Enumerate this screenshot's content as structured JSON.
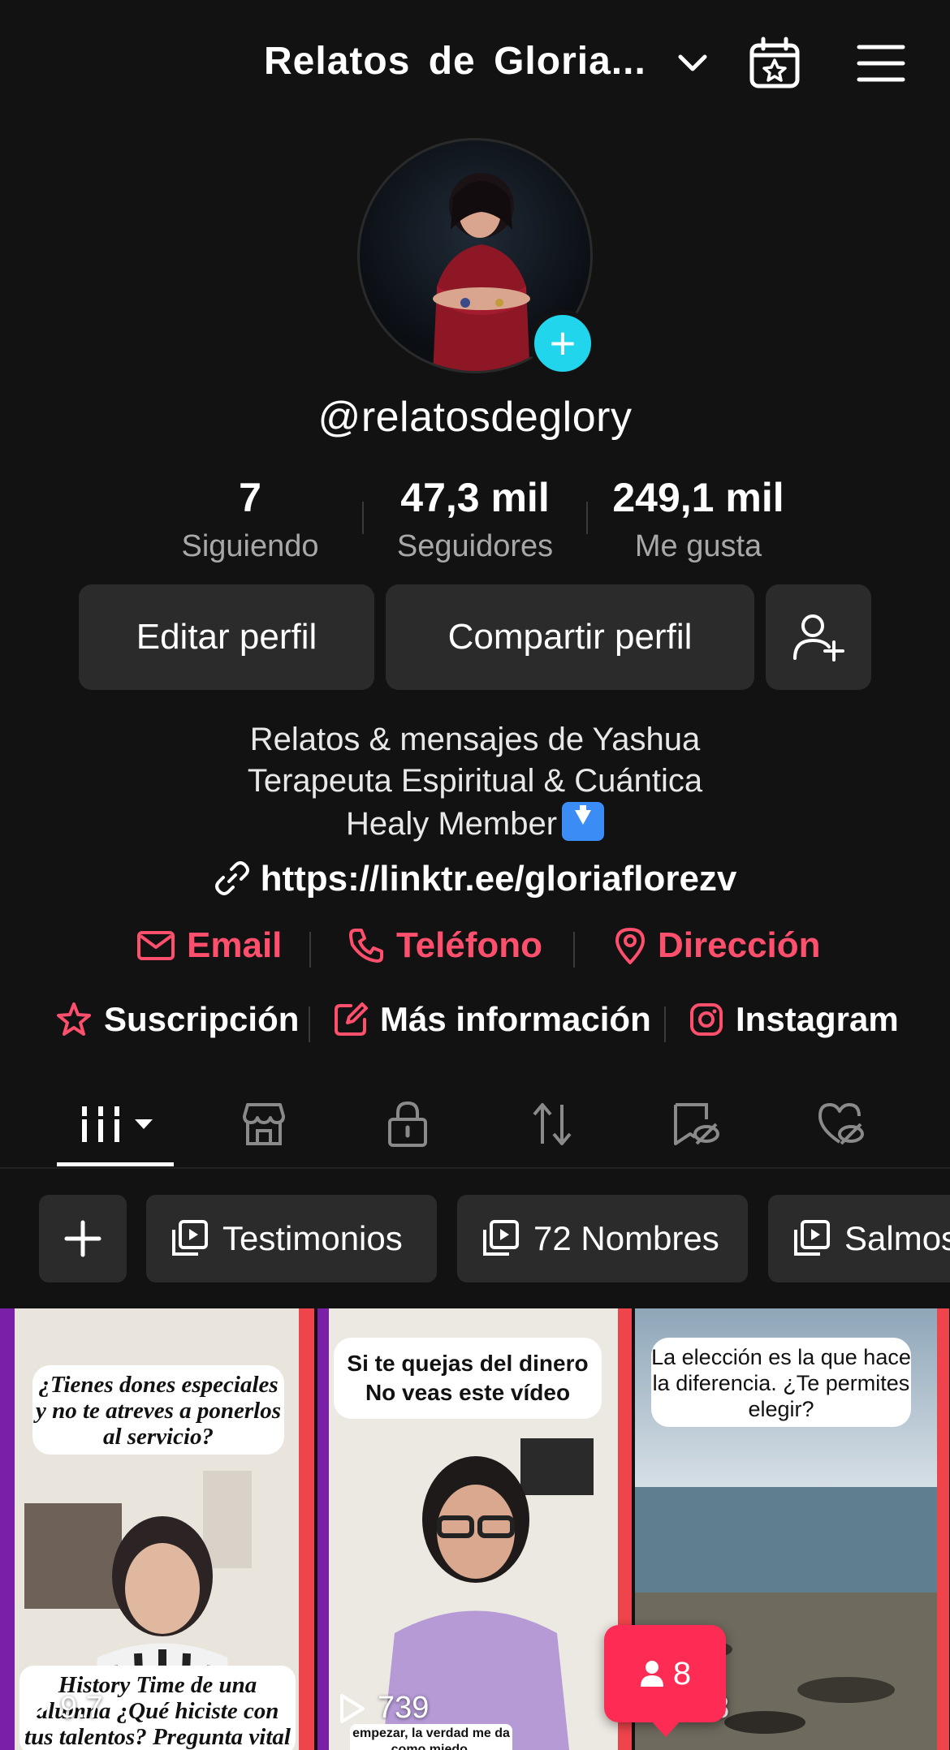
{
  "header": {
    "title": "Relatos  de  Gloria...",
    "icons": [
      "chevron-down-icon",
      "calendar-star-icon",
      "hamburger-menu-icon"
    ]
  },
  "profile": {
    "username": "@relatosdeglory",
    "stats": [
      {
        "value": "7",
        "label": "Siguiendo"
      },
      {
        "value": "47,3 mil",
        "label": "Seguidores"
      },
      {
        "value": "249,1 mil",
        "label": "Me gusta"
      }
    ],
    "buttons": {
      "edit": "Editar perfil",
      "share": "Compartir perfil"
    },
    "bio": {
      "line1": "Relatos & mensajes de Yashua",
      "line2": "Terapeuta Espiritual & Cuántica",
      "line3": "Healy Member"
    },
    "link": "https://linktr.ee/gloriaflorezv"
  },
  "contact": {
    "email": "Email",
    "phone": "Teléfono",
    "address": "Dirección",
    "accent_color": "#fe4f6d"
  },
  "extras": {
    "subscription": "Suscripción",
    "more_info": "Más información",
    "instagram": "Instagram"
  },
  "tabs": [
    "videos-grid-icon",
    "shop-icon",
    "lock-icon",
    "repost-icon",
    "tagged-icon",
    "liked-hidden-icon"
  ],
  "playlists": {
    "chips": [
      "Testimonios",
      "72 Nombres",
      "Salmos"
    ]
  },
  "videos": [
    {
      "caption": "¿Tienes dones especiales y no te atreves a ponerlos al servicio?",
      "bottom_caption": "History Time de una alumna ¿Qué hiciste con tus talentos? Pregunta vital",
      "views": "9.7"
    },
    {
      "caption": "Si te quejas del dinero No veas este vídeo",
      "bottom_caption": "empezar, la verdad me da como miedo.",
      "views": "739"
    },
    {
      "caption": "La elección es la que hace la diferencia. ¿Te permites elegir?",
      "views": "68"
    }
  ],
  "badge": {
    "count": "8"
  },
  "colors": {
    "background": "#121212",
    "button": "#2b2b2b",
    "accent_cyan": "#20d5ec",
    "accent_red": "#fe2c55"
  }
}
